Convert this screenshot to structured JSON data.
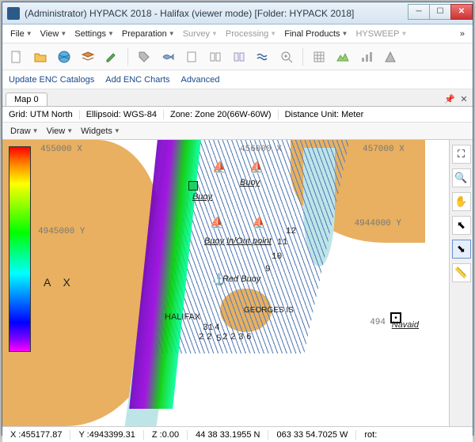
{
  "title": "(Administrator) HYPACK 2018 - Halifax (viewer mode)  [Folder: HYPACK 2018]",
  "menu": {
    "file": "File",
    "view": "View",
    "settings": "Settings",
    "preparation": "Preparation",
    "survey": "Survey",
    "processing": "Processing",
    "final": "Final Products",
    "hysweep": "HYSWEEP"
  },
  "linkbar": {
    "update": "Update ENC Catalogs",
    "add": "Add ENC Charts",
    "advanced": "Advanced"
  },
  "tab": "Map 0",
  "info": {
    "grid_label": "Grid:",
    "grid_val": "UTM North",
    "ell_label": "Ellipsoid:",
    "ell_val": "WGS-84",
    "zone_label": "Zone:",
    "zone_val": "Zone 20(66W-60W)",
    "dist_label": "Distance Unit:",
    "dist_val": "Meter"
  },
  "mapmenu": {
    "draw": "Draw",
    "view": "View",
    "widgets": "Widgets"
  },
  "labels": {
    "buoy1": "Buoy",
    "buoy2": "Buoy",
    "buoy3": "Buoy",
    "inchk": "In/Out point",
    "redbuoy": "Red Buoy",
    "halifax": "HALIFAX",
    "georges": "GEORGES IS",
    "navaid": "Navaid",
    "ax": "A  X"
  },
  "gridlabels": {
    "g1": "455000 X",
    "g2": "456000 X",
    "g3": "457000 X",
    "gy1": "4945000 Y",
    "gy2": "4944000 Y",
    "n494": "494"
  },
  "numbers": {
    "p9": "9",
    "p10": "10",
    "p11": "11",
    "p12": "12",
    "s2a": "2",
    "s2b": "2",
    "s2c": "2",
    "s2d": "2",
    "s3": "3",
    "s5": "5",
    "s6": "6",
    "s31": "31",
    "s4": "4"
  },
  "status": {
    "x_label": "X :",
    "x_val": "455177.87",
    "y_label": "Y :",
    "y_val": "4943399.31",
    "z_label": "Z :",
    "z_val": "0.00",
    "lat": "44 38 33.1955 N",
    "lon": "063 33 54.7025 W",
    "rot_label": "rot:"
  }
}
